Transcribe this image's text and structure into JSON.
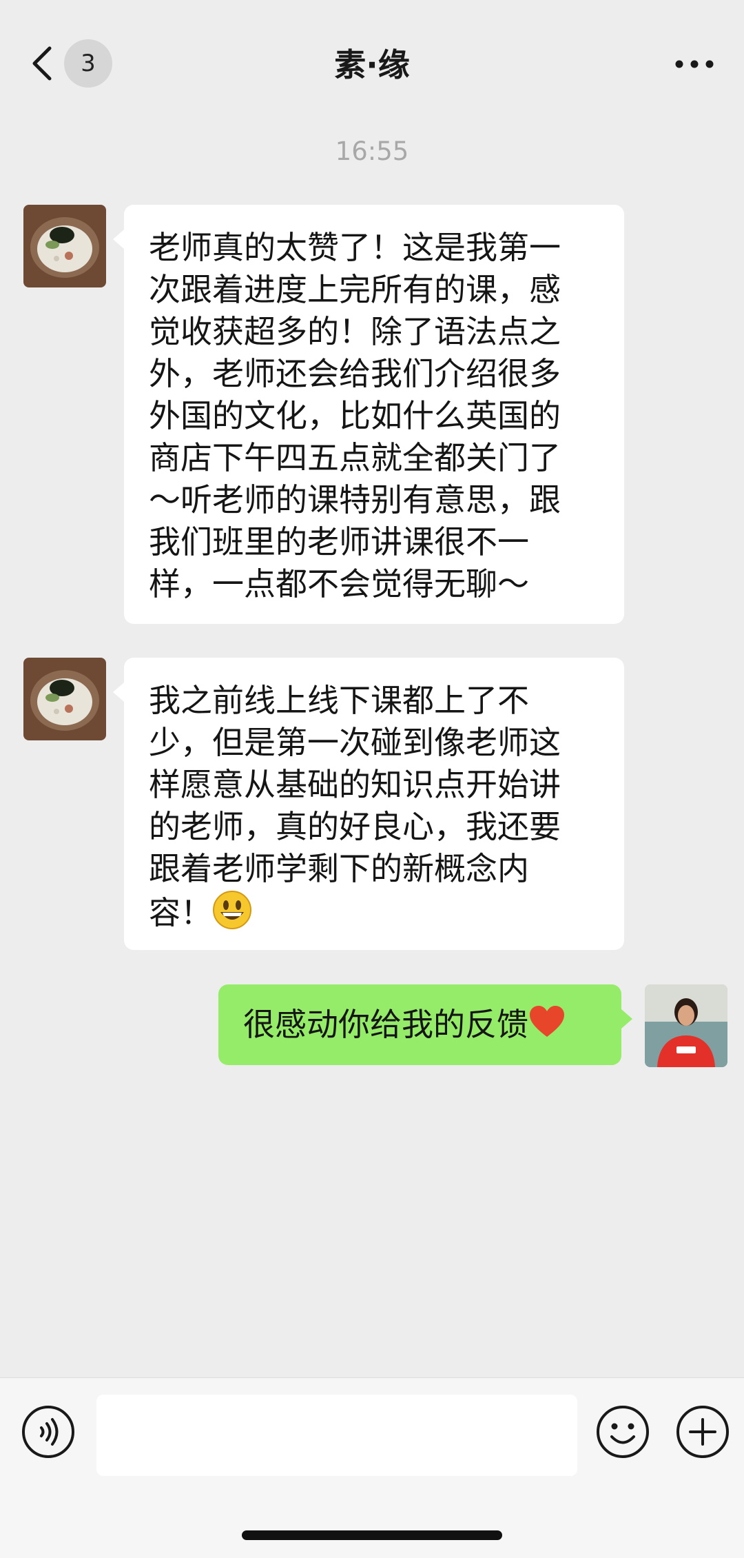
{
  "header": {
    "back_icon": "chevron-left-icon",
    "unread_count": "3",
    "title": "素·缘",
    "more_icon": "more-horizontal-icon"
  },
  "chat": {
    "timestamp": "16:55",
    "messages": [
      {
        "side": "left",
        "avatar": "food-bowl-avatar",
        "text": "老师真的太赞了！这是我第一\n次跟着进度上完所有的课，感\n觉收获超多的！除了语法点之\n外，老师还会给我们介绍很多\n外国的文化，比如什么英国的\n商店下午四五点就全都关门了\n～听老师的课特别有意思，跟\n我们班里的老师讲课很不一\n样，一点都不会觉得无聊～"
      },
      {
        "side": "left",
        "avatar": "food-bowl-avatar",
        "text": "我之前线上线下课都上了不\n少，但是第一次碰到像老师这\n样愿意从基础的知识点开始讲\n的老师，真的好良心，我还要\n跟着老师学剩下的新概念内\n容！",
        "emoji": "smiley-emoji"
      },
      {
        "side": "right",
        "avatar": "teacher-avatar",
        "text": "很感动你给我的反馈",
        "emoji": "red-heart-emoji"
      }
    ]
  },
  "input_bar": {
    "voice_icon": "voice-icon",
    "input_value": "",
    "emoji_icon": "emoji-icon",
    "plus_icon": "plus-circle-icon"
  },
  "colors": {
    "background": "#ededed",
    "incoming_bubble": "#ffffff",
    "outgoing_bubble": "#95ec69",
    "timestamp": "#a8a8a8"
  }
}
